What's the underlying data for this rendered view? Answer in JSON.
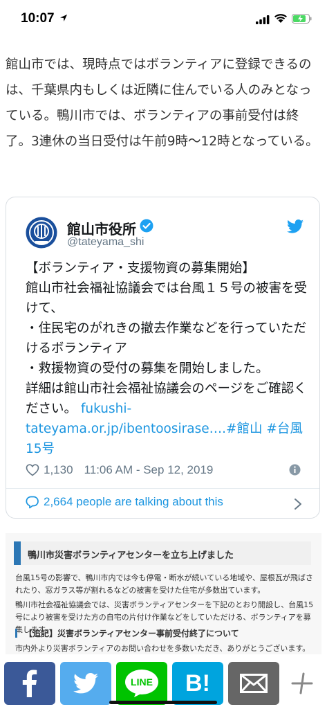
{
  "status_bar": {
    "time": "10:07"
  },
  "article": {
    "text": "館山市では、現時点ではボランティアに登録できるのは、千葉県内もしくは近隣に住んでいる人のみとなっている。鴨川市では、ボランティアの事前受付は終了。3連休の当日受付は午前9時〜12時となっている。"
  },
  "tweet": {
    "account_name": "館山市役所",
    "handle": "@tateyama_shi",
    "body": "【ボランティア・支援物資の募集開始】\n館山市社会福祉協議会では台風１５号の被害を受けて、\n・住民宅のがれきの撤去作業などを行っていただけるボランティア\n・救援物資の受付の募集を開始しました。\n詳細は館山市社会福祉協議会のページをご確認ください。",
    "link": "fukushi-tateyama.or.jp/ibentoosirase….",
    "hashtags": "#館山 #台風15号",
    "likes": "1,130",
    "timestamp": "11:06 AM - Sep 12, 2019",
    "replies_text": "2,664 people are talking about this"
  },
  "embedded_image": {
    "title": "鴨川市災害ボランティアセンターを立ち上げました",
    "paragraph1": "台風15号の影響で、鴨川市内では今も停電・断水が続いている地域や、屋根瓦が飛ばされたり、窓ガラス等が割れるなどの被害を受けた住宅が多数出ています。",
    "paragraph2": "鴨川市社会福祉協議会では、災害ボランティアセンターを下記のとおり開設し、台風15号により被害を受けた方の自宅の片付け作業などをしていただける、ボランティアを募集します。",
    "subheading": "【追記】災害ボランティアセンター事前受付終了について",
    "paragraph3": "市内外より災害ボランティアのお問い合わせを多数いただき、ありがとうございます。"
  },
  "share_bar": {
    "buttons": [
      {
        "icon": "facebook-icon",
        "color": "#3b5998"
      },
      {
        "icon": "twitter-icon",
        "color": "#55acee"
      },
      {
        "icon": "line-icon",
        "color": "#00c300",
        "label": "LINE"
      },
      {
        "icon": "hatena-bookmark-icon",
        "color": "#00a4de",
        "label": "B!"
      },
      {
        "icon": "mail-icon",
        "color": "#666666"
      },
      {
        "icon": "plus-icon",
        "color": "#888888"
      }
    ]
  }
}
